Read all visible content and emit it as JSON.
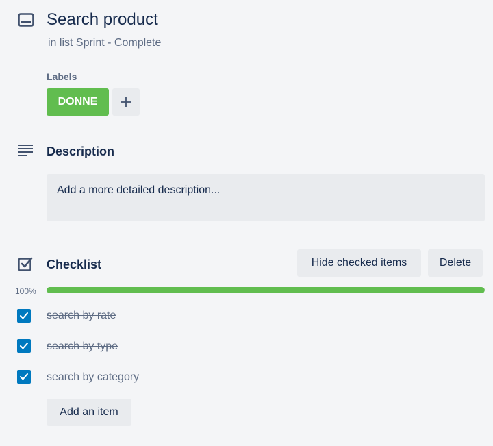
{
  "card": {
    "title": "Search product",
    "in_list_prefix": "in list",
    "list_name": "Sprint - Complete"
  },
  "labels": {
    "heading": "Labels",
    "items": [
      {
        "text": "DONNE",
        "color": "#61bd4f"
      }
    ],
    "add_icon": "plus-icon"
  },
  "description": {
    "title": "Description",
    "placeholder": "Add a more detailed description..."
  },
  "checklist": {
    "title": "Checklist",
    "hide_label": "Hide checked items",
    "delete_label": "Delete",
    "progress_text": "100%",
    "progress": 1.0,
    "items": [
      {
        "text": "search by rate",
        "checked": true
      },
      {
        "text": "search by type",
        "checked": true
      },
      {
        "text": "search by category",
        "checked": true
      }
    ],
    "add_item_label": "Add an item"
  },
  "colors": {
    "accent_green": "#61bd4f",
    "checkbox_blue": "#0079bf",
    "button_bg": "#e9ebee",
    "page_bg": "#f4f5f7"
  }
}
